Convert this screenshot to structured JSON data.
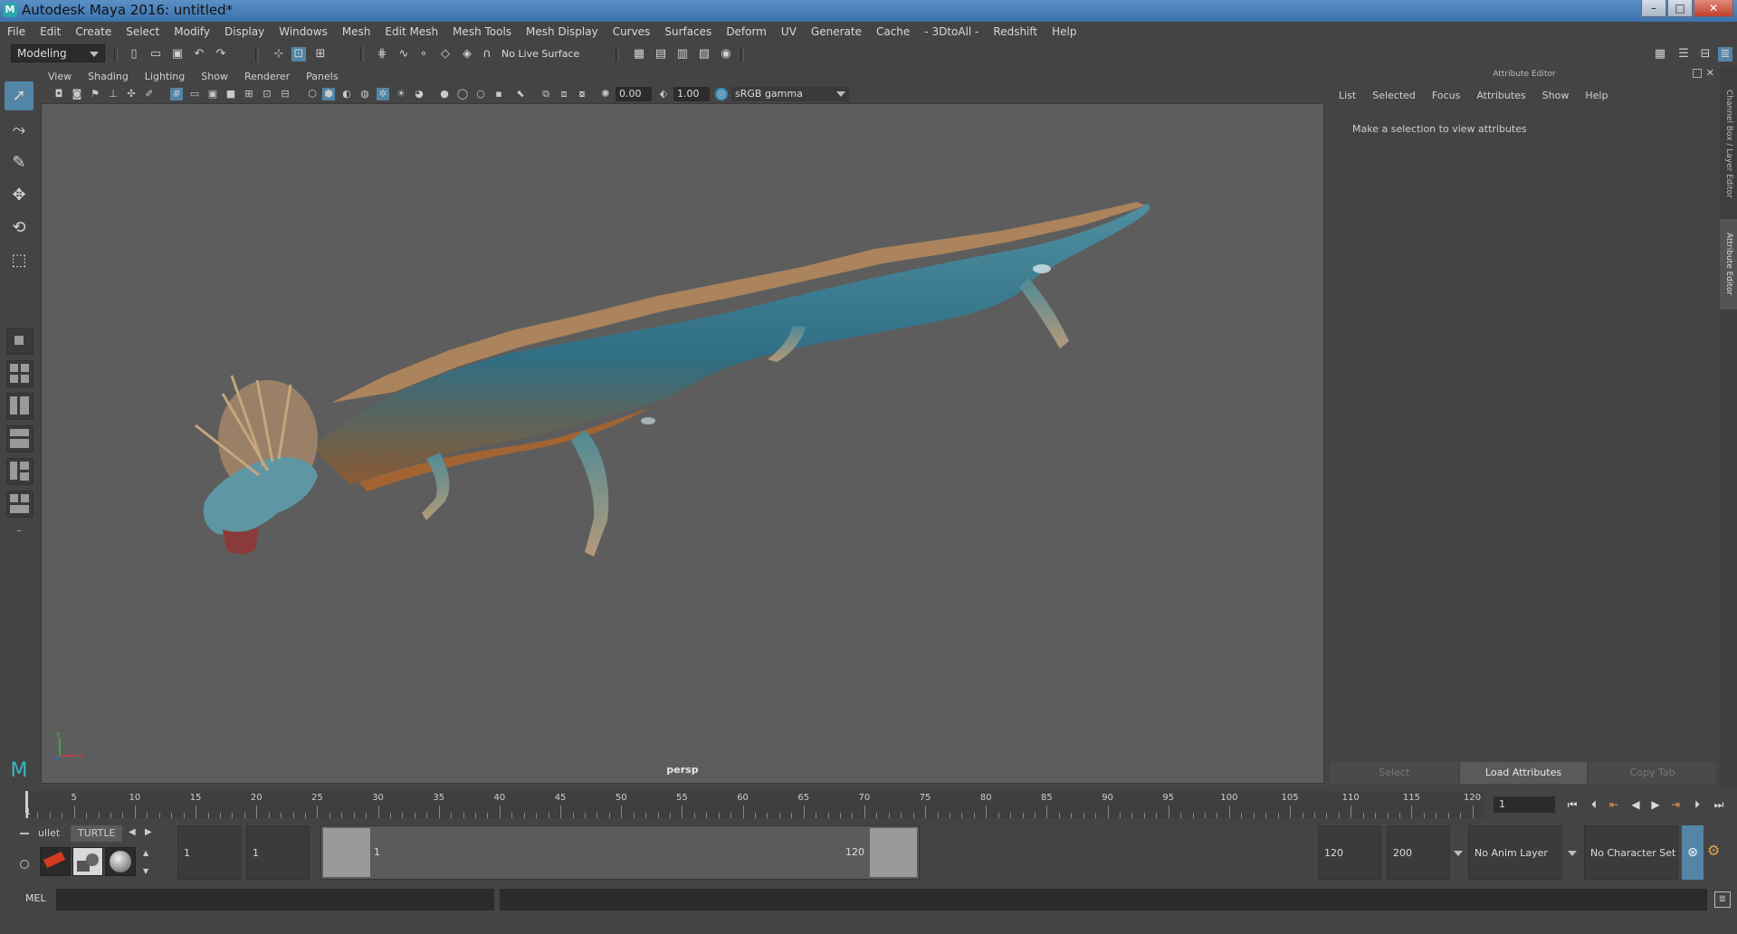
{
  "window": {
    "title": "Autodesk Maya 2016: untitled*",
    "minimize": "–",
    "maximize": "□",
    "close": "✕"
  },
  "menubar": [
    "File",
    "Edit",
    "Create",
    "Select",
    "Modify",
    "Display",
    "Windows",
    "Mesh",
    "Edit Mesh",
    "Mesh Tools",
    "Mesh Display",
    "Curves",
    "Surfaces",
    "Deform",
    "UV",
    "Generate",
    "Cache",
    "- 3DtoAll -",
    "Redshift",
    "Help"
  ],
  "statusline": {
    "mode": "Modeling",
    "live_surface": "No Live Surface"
  },
  "viewport": {
    "menu": [
      "View",
      "Shading",
      "Lighting",
      "Show",
      "Renderer",
      "Panels"
    ],
    "near_value": "0.00",
    "far_value": "1.00",
    "color_space": "sRGB gamma",
    "camera": "persp",
    "axis_x": "x",
    "axis_y": "y"
  },
  "attribute_editor": {
    "header": "Attribute Editor",
    "menu": [
      "List",
      "Selected",
      "Focus",
      "Attributes",
      "Show",
      "Help"
    ],
    "message": "Make a selection to view attributes",
    "buttons": {
      "select": "Select",
      "load": "Load Attributes",
      "copy": "Copy Tab"
    },
    "side_tabs": {
      "channel_box": "Channel Box / Layer Editor",
      "attr_editor": "Attribute Editor"
    }
  },
  "timeline": {
    "ticks": [
      "5",
      "10",
      "15",
      "20",
      "25",
      "30",
      "35",
      "40",
      "45",
      "50",
      "55",
      "60",
      "65",
      "70",
      "75",
      "80",
      "85",
      "90",
      "95",
      "100",
      "105",
      "110",
      "115",
      "120"
    ],
    "start_label": "1",
    "current_frame": "1"
  },
  "range": {
    "shelf_tab_1": "ullet",
    "shelf_tab_2": "TURTLE",
    "start_field": "1",
    "playback_start": "1",
    "range_start": "1",
    "range_end": "120",
    "playback_end": "120",
    "end_field": "200",
    "anim_layer": "No Anim Layer",
    "character_set": "No Character Set"
  },
  "command": {
    "label": "MEL"
  }
}
